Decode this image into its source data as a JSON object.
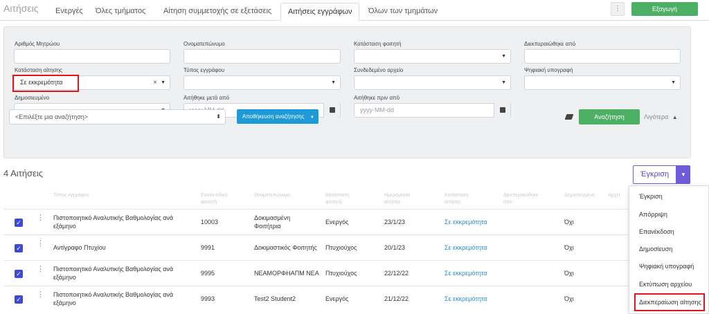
{
  "page_title": "Αιτήσεις",
  "tabs": [
    {
      "label": "Ενεργές"
    },
    {
      "label": "Όλες τμήματος"
    },
    {
      "label": "Αίτηση συμμετοχής σε εξετάσεις"
    },
    {
      "label": "Αιτήσεις εγγράφων"
    },
    {
      "label": "Όλων των τμημάτων"
    }
  ],
  "toolbar": {
    "kebab": "⋮",
    "export_label": "Εξαγωγή"
  },
  "filters": {
    "student_id_label": "Αριθμός Μητρώου",
    "full_name_label": "Ονοματεπώνυμο",
    "student_status_label": "Κατάσταση φοιτητή",
    "processed_by_label": "Διεκπεραιώθηκε από",
    "request_status_label": "Κατάσταση αίτησης",
    "request_status_value": "Σε εκκρεμότητα",
    "doc_type_label": "Τύπος εγγράφου",
    "linked_file_label": "Συνδεδεμένο αρχείο",
    "digital_signature_label": "Ψηφιακή υπογραφή",
    "published_label": "Δημοσιευμένο",
    "requested_after_label": "Αιτήθηκε μετά από",
    "requested_after_placeholder": "yyyy-MM-dd",
    "requested_before_label": "Αιτήθηκε πριν από",
    "requested_before_placeholder": "yyyy-MM-dd",
    "saved_search_placeholder": "<Επιλέξτε μια αναζήτηση>",
    "save_search_label": "Αποθήκευση αναζήτησης",
    "search_label": "Αναζήτηση",
    "less_label": "Λιγότερα"
  },
  "results": {
    "count_label": "4 Αιτήσεις",
    "approve_label": "Έγκριση"
  },
  "table": {
    "columns": [
      "Τύπος εγγράφου",
      "Ενιαίο ειδικό φοιτητή",
      "Ονοματεπώνυμο",
      "Κατάσταση φοιτητή",
      "Ημερομηνία αίτησης",
      "Κατάσταση αίτησης",
      "Διεκπεραιώθηκε από",
      "Δημοσιευμένο",
      "Αρχεί"
    ],
    "rows": [
      {
        "doc_type": "Πιστοποιητικό Αναλυτικής Βαθμολογίας ανά εξάμηνο",
        "id": "10003",
        "name": "Δοκιμασμένη Φοιτήτρια",
        "student_status": "Ενεργός",
        "date": "23/1/23",
        "status": "Σε εκκρεμότητα",
        "published": "Όχι"
      },
      {
        "doc_type": "Αντίγραφο Πτυχίου",
        "id": "9991",
        "name": "Δοκιμαστικός Φοιτητής",
        "student_status": "Πτυχιούχος",
        "date": "20/1/23",
        "status": "Σε εκκρεμότητα",
        "published": "Όχι"
      },
      {
        "doc_type": "Πιστοποιητικό Αναλυτικής Βαθμολογίας ανά εξάμηνο",
        "id": "9995",
        "name": "ΝΕΑΜΟΡΦΗΑΠΜ ΝΕΑ",
        "student_status": "Πτυχιούχος",
        "date": "22/12/22",
        "status": "Σε εκκρεμότητα",
        "published": "Όχι"
      },
      {
        "doc_type": "Πιστοποιητικό Αναλυτικής Βαθμολογίας ανά εξάμηνο",
        "id": "9993",
        "name": "Test2 Student2",
        "student_status": "Ενεργός",
        "date": "21/12/22",
        "status": "Σε εκκρεμότητα",
        "published": "Όχι"
      }
    ]
  },
  "action_menu": [
    {
      "label": "Έγκριση"
    },
    {
      "label": "Απόρριψη"
    },
    {
      "label": "Επανέκδοση"
    },
    {
      "label": "Δημοσίευση"
    },
    {
      "label": "Ψηφιακή υπογραφή"
    },
    {
      "label": "Εκτύπωση αρχείου"
    },
    {
      "label": "Διεκπεραίωση αίτησης"
    }
  ],
  "colors": {
    "green": "#4caf64",
    "blue": "#1e9bd7",
    "purple": "#6f5bd9",
    "highlight": "#e0151b"
  }
}
